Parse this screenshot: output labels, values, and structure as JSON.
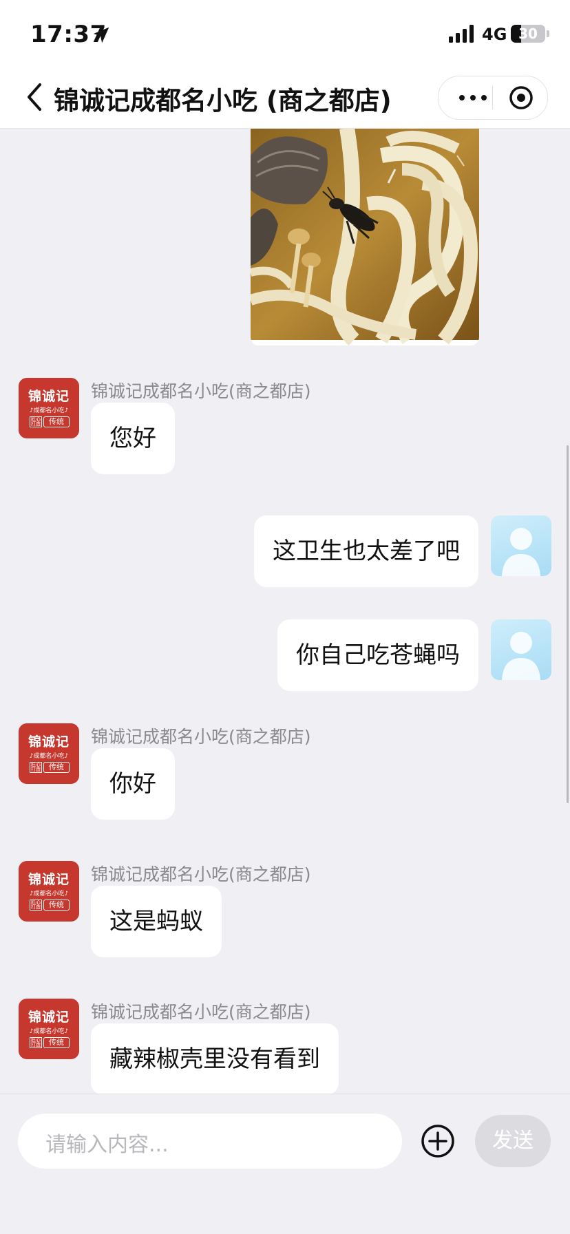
{
  "status_bar": {
    "time": "17:37",
    "network": "4G",
    "battery": "30",
    "battery_level_percent": 30
  },
  "header": {
    "title": "锦诚记成都名小吃 (商之都店)"
  },
  "shop": {
    "name": "锦诚记成都名小吃(商之都店)",
    "avatar": {
      "brand": "锦诚记",
      "tagline": "♪成都名小吃♪",
      "stamp": "传统",
      "stamp_side": "匠心打造"
    }
  },
  "messages": [
    {
      "from": "user",
      "type": "image",
      "icon": "photo-of-noodles-with-insect"
    },
    {
      "from": "shop",
      "sender": "锦诚记成都名小吃(商之都店)",
      "text": "您好"
    },
    {
      "from": "user",
      "text": "这卫生也太差了吧"
    },
    {
      "from": "user",
      "text": "你自己吃苍蝇吗"
    },
    {
      "from": "shop",
      "sender": "锦诚记成都名小吃(商之都店)",
      "text": "你好"
    },
    {
      "from": "shop",
      "sender": "锦诚记成都名小吃(商之都店)",
      "text": "这是蚂蚁"
    },
    {
      "from": "shop",
      "sender": "锦诚记成都名小吃(商之都店)",
      "text": "藏辣椒壳里没有看到"
    }
  ],
  "input": {
    "placeholder": "请输入内容...",
    "send_label": "发送"
  },
  "colors": {
    "shop_avatar": "#c6372d",
    "background": "#f0f0f4",
    "bubble": "#ffffff"
  }
}
